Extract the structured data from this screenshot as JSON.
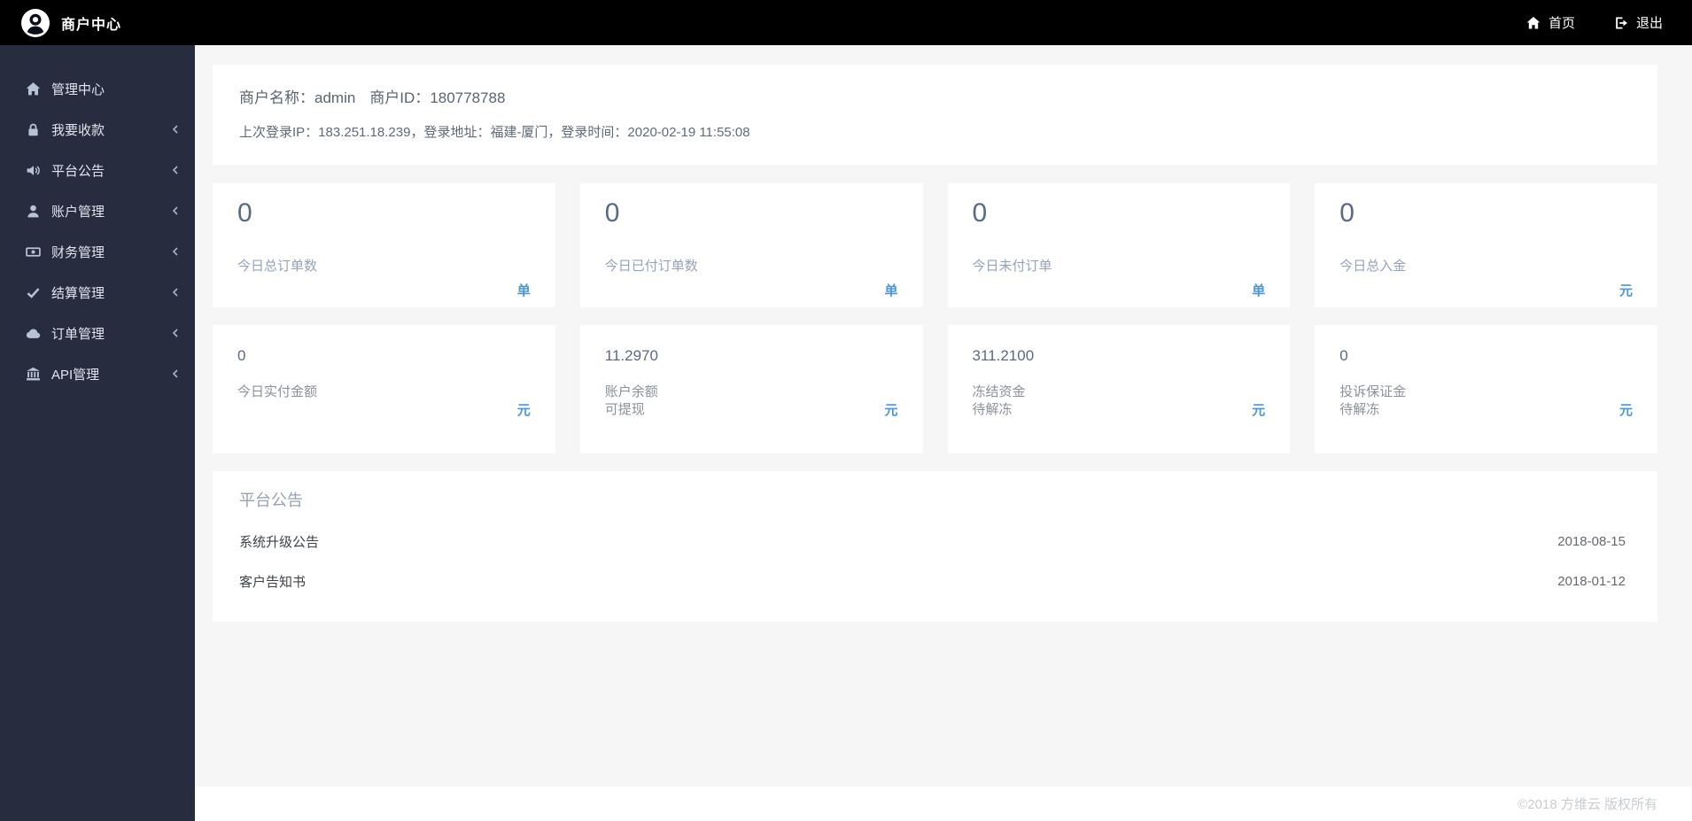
{
  "topbar": {
    "title": "商户中心",
    "home_label": "首页",
    "logout_label": "退出"
  },
  "sidebar": {
    "items": [
      {
        "label": "管理中心",
        "icon": "home-icon",
        "has_submenu": false
      },
      {
        "label": "我要收款",
        "icon": "lock-icon",
        "has_submenu": true
      },
      {
        "label": "平台公告",
        "icon": "volume-icon",
        "has_submenu": true
      },
      {
        "label": "账户管理",
        "icon": "user-icon",
        "has_submenu": true
      },
      {
        "label": "财务管理",
        "icon": "money-icon",
        "has_submenu": true
      },
      {
        "label": "结算管理",
        "icon": "check-icon",
        "has_submenu": true
      },
      {
        "label": "订单管理",
        "icon": "cloud-icon",
        "has_submenu": true
      },
      {
        "label": "API管理",
        "icon": "bank-icon",
        "has_submenu": true
      }
    ]
  },
  "merchant": {
    "name_label": "商户名称：",
    "name": "admin",
    "id_label": "商户ID：",
    "id": "180778788",
    "login_line": "上次登录IP：183.251.18.239，登录地址：福建-厦门，登录时间：2020-02-19 11:55:08"
  },
  "stats": {
    "row1": [
      {
        "value": "0",
        "label": "今日总订单数",
        "unit": "单"
      },
      {
        "value": "0",
        "label": "今日已付订单数",
        "unit": "单"
      },
      {
        "value": "0",
        "label": "今日未付订单",
        "unit": "单"
      },
      {
        "value": "0",
        "label": "今日总入金",
        "unit": "元"
      }
    ],
    "row2": [
      {
        "value": "0",
        "label": "今日实付金额",
        "sublabel": "",
        "unit": "元"
      },
      {
        "value": "11.2970",
        "label": "账户余额",
        "sublabel": "可提现",
        "unit": "元"
      },
      {
        "value": "311.2100",
        "label": "冻结资金",
        "sublabel": "待解冻",
        "unit": "元"
      },
      {
        "value": "0",
        "label": "投诉保证金",
        "sublabel": "待解冻",
        "unit": "元"
      }
    ]
  },
  "announcements": {
    "title": "平台公告",
    "items": [
      {
        "title": "系统升级公告",
        "date": "2018-08-15"
      },
      {
        "title": "客户告知书",
        "date": "2018-01-12"
      }
    ]
  },
  "footer": {
    "copyright": "©2018 方维云 版权所有"
  },
  "colors": {
    "topbar_bg": "#000000",
    "sidebar_bg": "#272c3f",
    "content_bg": "#f6f6f7",
    "accent_blue": "#4a97d5",
    "value_color": "#5a6a85"
  }
}
